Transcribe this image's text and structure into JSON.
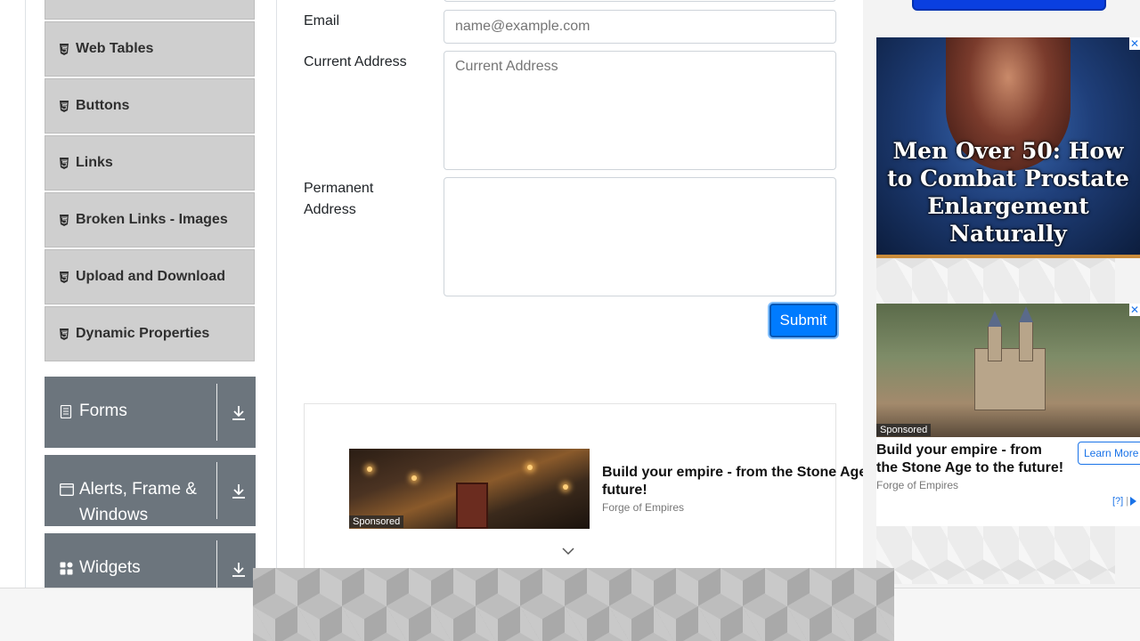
{
  "sidebar": {
    "elements_items": [
      {
        "label": "Web Tables",
        "icon": "html5-icon"
      },
      {
        "label": "Buttons",
        "icon": "html5-icon"
      },
      {
        "label": "Links",
        "icon": "html5-icon"
      },
      {
        "label": "Broken Links - Images",
        "icon": "html5-icon"
      },
      {
        "label": "Upload and Download",
        "icon": "html5-icon"
      },
      {
        "label": "Dynamic Properties",
        "icon": "html5-icon"
      }
    ],
    "groups": [
      {
        "label": "Forms",
        "icon": "form-icon"
      },
      {
        "label_line1": "Alerts, Frame &",
        "label_line2": "Windows",
        "icon": "window-icon"
      },
      {
        "label": "Widgets",
        "icon": "widgets-icon"
      }
    ]
  },
  "form": {
    "email_label": "Email",
    "email_placeholder": "name@example.com",
    "current_address_label": "Current Address",
    "current_address_placeholder": "Current Address",
    "permanent_address_label_line1": "Permanent",
    "permanent_address_label_line2": "Address",
    "submit_label": "Submit"
  },
  "inline_ad": {
    "sponsored": "Sponsored",
    "title_line1": "Build your empire - from the Stone Age to the",
    "title_line2": "future!",
    "source": "Forge of Empires"
  },
  "right_ads": {
    "prostate_headline_line1": "Men Over 50: How",
    "prostate_headline_line2": "to Combat Prostate",
    "prostate_headline_line3": "Enlargement",
    "prostate_headline_line4": "Naturally",
    "castle_sponsored": "Sponsored",
    "castle_title_line1": "Build your empire - from",
    "castle_title_line2": "the Stone Age to the future!",
    "castle_source": "Forge of Empires",
    "learn_more": "Learn More",
    "adchoices": "[?]"
  },
  "colors": {
    "accent": "#007bff",
    "group_header_bg": "#6c757d",
    "sub_item_bg": "#cfcfcf"
  }
}
